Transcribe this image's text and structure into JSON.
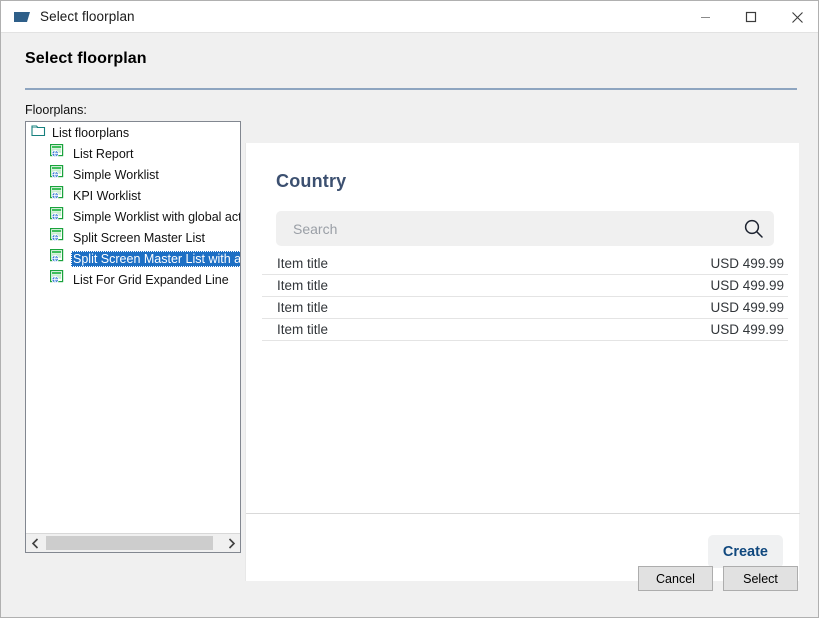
{
  "window": {
    "titlebar_title": "Select floorplan",
    "app_icon": "floorplan-flag-icon",
    "minimize_label": "Minimize",
    "maximize_label": "Maximize",
    "close_label": "Close"
  },
  "dialog": {
    "heading": "Select floorplan",
    "tree_label": "Floorplans:",
    "accent_color": "#8ea5c0"
  },
  "tree": {
    "root": {
      "label": "List floorplans",
      "icon": "folder-icon"
    },
    "items": [
      {
        "label": "List Report",
        "icon": "floorplan-page-icon",
        "selected": false
      },
      {
        "label": "Simple Worklist",
        "icon": "floorplan-page-icon",
        "selected": false
      },
      {
        "label": "KPI Worklist",
        "icon": "floorplan-page-icon",
        "selected": false
      },
      {
        "label": "Simple Worklist with global action",
        "icon": "floorplan-page-icon",
        "selected": false
      },
      {
        "label": "Split Screen Master List",
        "icon": "floorplan-page-icon",
        "selected": false
      },
      {
        "label": "Split Screen Master List with amount",
        "icon": "floorplan-page-icon",
        "selected": true
      },
      {
        "label": "List For Grid Expanded Line",
        "icon": "floorplan-page-icon",
        "selected": false
      }
    ],
    "selection_color": "#1d6fc4",
    "scrollbar": {
      "left_arrow": "chevron-left-icon",
      "right_arrow": "chevron-right-icon"
    }
  },
  "preview": {
    "heading": "Country",
    "heading_color": "#3c5070",
    "search": {
      "value": "",
      "placeholder": "Search",
      "icon": "search-icon"
    },
    "rows": [
      {
        "title": "Item title",
        "amount": "USD 499.99"
      },
      {
        "title": "Item title",
        "amount": "USD 499.99"
      },
      {
        "title": "Item title",
        "amount": "USD 499.99"
      },
      {
        "title": "Item title",
        "amount": "USD 499.99"
      }
    ],
    "create_label": "Create",
    "create_color": "#10487e"
  },
  "footer": {
    "cancel_label": "Cancel",
    "select_label": "Select"
  }
}
